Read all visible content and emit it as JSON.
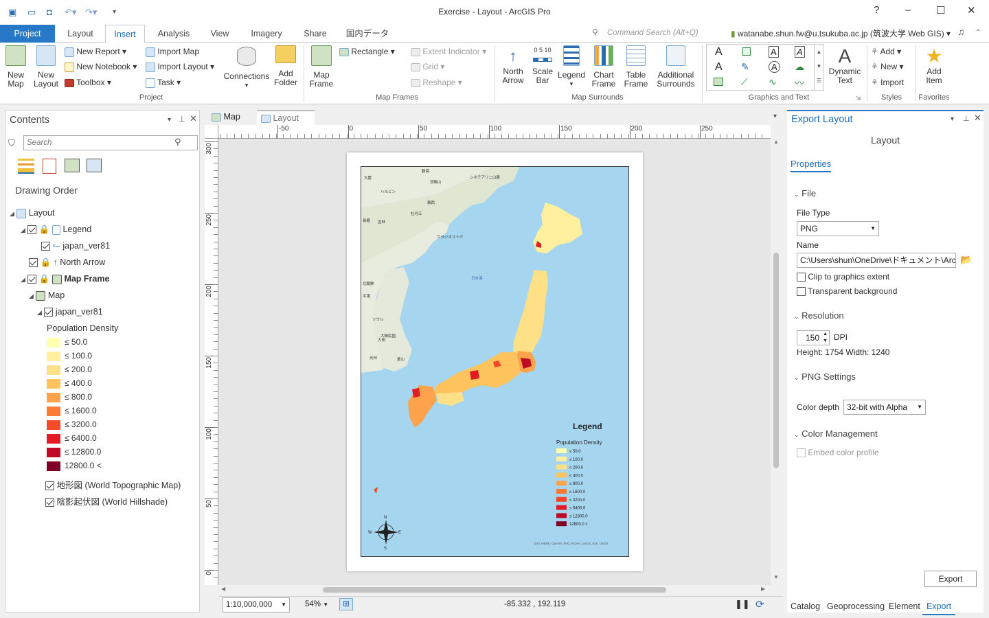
{
  "window": {
    "title": "Exercise - Layout - ArcGIS Pro",
    "help": "?",
    "minimize": "–",
    "maximize": "☐",
    "close": "✕"
  },
  "tabs": {
    "project": "Project",
    "layout": "Layout",
    "insert": "Insert",
    "analysis": "Analysis",
    "view": "View",
    "imagery": "Imagery",
    "share": "Share",
    "japan": "国内データ"
  },
  "search": {
    "placeholder": "Command Search (Alt+Q)"
  },
  "user": {
    "account": "watanabe.shun.fw@u.tsukuba.ac.jp (筑波大学 Web GIS)"
  },
  "ribbon": {
    "project": {
      "group_label": "Project",
      "new_map": "New\nMap",
      "new_layout": "New\nLayout",
      "new_report": "New Report",
      "new_notebook": "New Notebook",
      "toolbox": "Toolbox",
      "import_map": "Import Map",
      "import_layout": "Import Layout",
      "task": "Task",
      "connections": "Connections",
      "add_folder": "Add\nFolder"
    },
    "map_frames": {
      "group_label": "Map Frames",
      "map_frame": "Map\nFrame",
      "rectangle": "Rectangle",
      "extent_indicator": "Extent Indicator",
      "grid": "Grid",
      "reshape": "Reshape"
    },
    "map_surrounds": {
      "group_label": "Map Surrounds",
      "north_arrow": "North\nArrow",
      "scale_bar": "Scale\nBar",
      "legend": "Legend",
      "chart_frame": "Chart\nFrame",
      "table_frame": "Table\nFrame",
      "additional_surrounds": "Additional\nSurrounds"
    },
    "graphics_text": {
      "group_label": "Graphics and Text",
      "dynamic_text": "Dynamic\nText"
    },
    "styles": {
      "group_label": "Styles",
      "add": "Add",
      "new": "New",
      "import": "Import"
    },
    "favorites": {
      "group_label": "Favorites",
      "add_item": "Add\nItem"
    }
  },
  "contents": {
    "title": "Contents",
    "search_placeholder": "Search",
    "section": "Drawing Order",
    "items": {
      "layout": "Layout",
      "legend": "Legend",
      "legend_layer": "japan_ver81",
      "north_arrow": "North Arrow",
      "map_frame": "Map Frame",
      "map": "Map",
      "layer": "japan_ver81",
      "field": "Population Density",
      "topo": "地形図 (World Topographic Map)",
      "hillshade": "陰影起伏図 (World Hillshade)"
    },
    "classes": [
      {
        "label": "≤ 50.0",
        "color": "#ffffb2"
      },
      {
        "label": "≤ 100.0",
        "color": "#fff0a0"
      },
      {
        "label": "≤ 200.0",
        "color": "#fee187"
      },
      {
        "label": "≤ 400.0",
        "color": "#fec35c"
      },
      {
        "label": "≤ 800.0",
        "color": "#fda34b"
      },
      {
        "label": "≤ 1600.0",
        "color": "#fc7a36"
      },
      {
        "label": "≤ 3200.0",
        "color": "#f44a2a"
      },
      {
        "label": "≤ 6400.0",
        "color": "#e21c25"
      },
      {
        "label": "≤ 12800.0",
        "color": "#bf0a26"
      },
      {
        "label": "12800.0 <",
        "color": "#800026"
      }
    ]
  },
  "view": {
    "tab_map": "Map",
    "tab_layout": "Layout",
    "ruler_h": [
      "-50",
      "0",
      "50",
      "100",
      "150",
      "200",
      "250"
    ],
    "ruler_v": [
      "300",
      "250",
      "200",
      "150",
      "100",
      "50",
      "0"
    ],
    "map_labels": {
      "daikei": "大慶",
      "tsuruoka": "鶴崗",
      "sofuku": "双鴨山",
      "harbin": "ハルビン",
      "jixi": "鶏西",
      "mudan": "牡丹江",
      "sikhote": "シホテアリニ山脈",
      "changchun": "長春",
      "jilin": "吉林",
      "vladivostok": "ウラジオストク",
      "nk": "北朝鮮",
      "pyongyang": "平壌",
      "sea": "日本海",
      "seoul": "ソウル",
      "korea": "大韓民国",
      "daejeon": "大田",
      "gwangju": "光州",
      "busan": "釜山"
    },
    "legend": {
      "title": "Legend",
      "field": "Population Density"
    },
    "compass": {
      "n": "N",
      "s": "S",
      "e": "E",
      "w": "W"
    },
    "attribution": "Esri, HERE, Garmin, FAO, NOAA, USGS, Esri, USGS"
  },
  "status": {
    "scale": "1:10,000,000",
    "zoom": "54%",
    "coords": "-85.332 , 192.119"
  },
  "export": {
    "title": "Export Layout",
    "subtitle": "Layout",
    "properties": "Properties",
    "file_section": "File",
    "file_type_label": "File Type",
    "file_type": "PNG",
    "name_label": "Name",
    "name_value": "C:\\Users\\shun\\OneDrive\\ドキュメント\\ArcGIS",
    "clip": "Clip to graphics extent",
    "transparent": "Transparent background",
    "resolution_section": "Resolution",
    "dpi_value": "150",
    "dpi_label": "DPI",
    "size_text": "Height: 1754 Width: 1240",
    "png_section": "PNG Settings",
    "color_depth_label": "Color depth",
    "color_depth": "32-bit with Alpha",
    "color_mgmt_section": "Color Management",
    "embed": "Embed color profile",
    "export_button": "Export"
  },
  "bottom_tabs": {
    "catalog": "Catalog",
    "geoprocessing": "Geoprocessing",
    "element": "Element",
    "export": "Export"
  }
}
